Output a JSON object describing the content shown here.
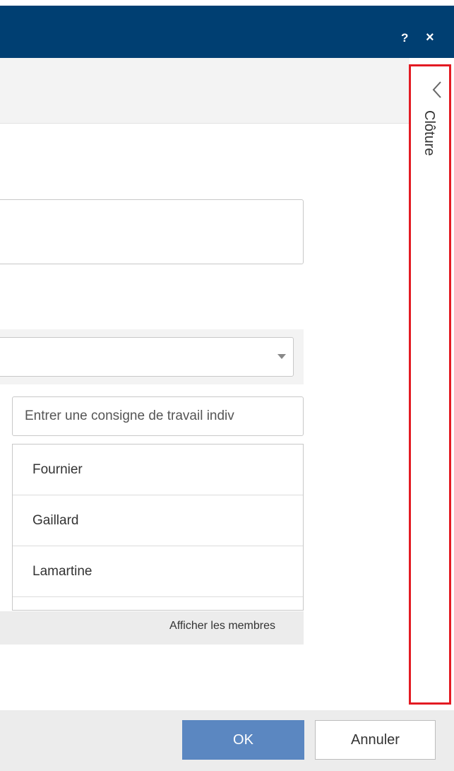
{
  "titlebar": {
    "help_label": "?",
    "close_label": "×",
    "color": "#003f72"
  },
  "side_panel": {
    "label": "Clôture",
    "border_color": "#e31b23"
  },
  "instruction": {
    "placeholder": "Entrer une consigne de travail indiv"
  },
  "members": {
    "items": [
      {
        "name": "Fournier"
      },
      {
        "name": "Gaillard"
      },
      {
        "name": "Lamartine"
      },
      {
        "name": ""
      }
    ],
    "show_members_label": "Afficher les membres"
  },
  "buttons": {
    "ok_label": "OK",
    "cancel_label": "Annuler",
    "ok_color": "#5b87c1"
  }
}
